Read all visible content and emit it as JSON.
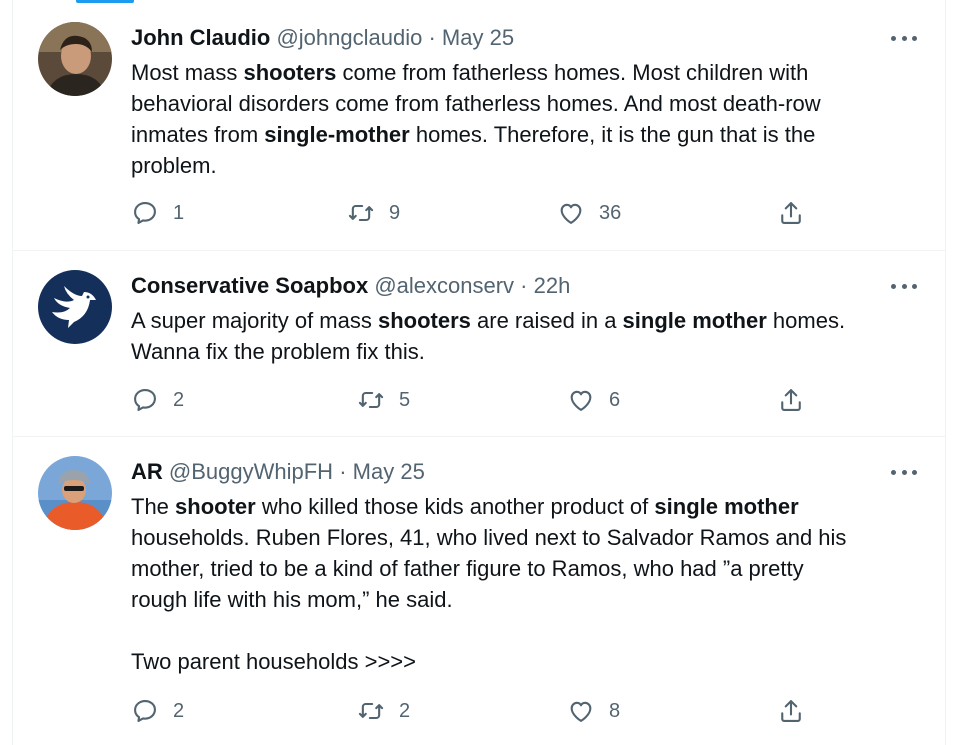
{
  "tweets": [
    {
      "name": "John Claudio",
      "handle": "@johngclaudio",
      "time": "May 25",
      "lines": [
        [
          {
            "t": "Most mass "
          },
          {
            "t": "shooters",
            "b": true
          },
          {
            "t": " come from fatherless homes. Most children with"
          }
        ],
        [
          {
            "t": "behavioral disorders come from fatherless homes. And most death-row"
          }
        ],
        [
          {
            "t": "inmates from "
          },
          {
            "t": "single-mother",
            "b": true
          },
          {
            "t": " homes. Therefore, it is the gun that is the"
          }
        ],
        [
          {
            "t": "problem."
          }
        ]
      ],
      "replies": "1",
      "retweets": "9",
      "likes": "36"
    },
    {
      "name": "Conservative Soapbox",
      "handle": "@alexconserv",
      "time": "22h",
      "lines": [
        [
          {
            "t": "A super majority of mass "
          },
          {
            "t": "shooters",
            "b": true
          },
          {
            "t": " are raised in a "
          },
          {
            "t": "single mother",
            "b": true
          },
          {
            "t": " homes."
          }
        ],
        [
          {
            "t": "Wanna fix the problem fix this."
          }
        ]
      ],
      "replies": "2",
      "retweets": "5",
      "likes": "6"
    },
    {
      "name": "AR",
      "handle": "@BuggyWhipFH",
      "time": "May 25",
      "lines": [
        [
          {
            "t": "The "
          },
          {
            "t": "shooter",
            "b": true
          },
          {
            "t": " who killed those kids another product of "
          },
          {
            "t": "single mother",
            "b": true
          }
        ],
        [
          {
            "t": "households. Ruben Flores, 41, who lived next to Salvador Ramos and his"
          }
        ],
        [
          {
            "t": "mother, tried to be a kind of father figure to Ramos, who had ”a pretty"
          }
        ],
        [
          {
            "t": "rough life with his mom,” he said."
          }
        ],
        [
          {
            "t": ""
          }
        ],
        [
          {
            "t": "Two parent households >>>>"
          }
        ]
      ],
      "replies": "2",
      "retweets": "2",
      "likes": "8"
    }
  ],
  "colors": {
    "text": "#0f1419",
    "secondary": "#536471",
    "accent": "#1d9bf0",
    "divider": "#eff3f4"
  },
  "icons": {
    "reply": "reply-icon",
    "retweet": "retweet-icon",
    "like": "heart-icon",
    "share": "share-icon",
    "more": "more-icon"
  }
}
